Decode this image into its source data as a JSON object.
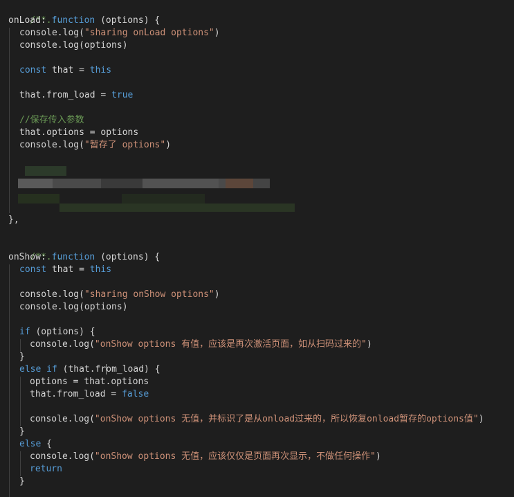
{
  "colors": {
    "background": "#1e1e1e",
    "keyword": "#569cd6",
    "string": "#ce9178",
    "comment": "#6a9955",
    "text": "#d4d4d4"
  },
  "code": {
    "l1_collapsed": "/**...",
    "l2_name": "onLoad",
    "l2_colon": ": ",
    "l2_function": "function",
    "l2_params": " (options) {",
    "l3_call": "console.log(",
    "l3_str": "\"sharing onLoad options\"",
    "l3_close": ")",
    "l4": "console.log(options)",
    "l5_const": "const",
    "l5_that": " that = ",
    "l5_this": "this",
    "l6_that": "that.from_load = ",
    "l6_true": "true",
    "l7_comment": "//保存传入参数",
    "l8": "that.options = options",
    "l9_call": "console.log(",
    "l9_str": "\"暂存了 options\"",
    "l9_close": ")",
    "l10_close": "},",
    "l11_collapsed": "/**...",
    "l12_name": "onShow",
    "l12_colon": ": ",
    "l12_function": "function",
    "l12_params": " (options) {",
    "l13_const": "const",
    "l13_that": " that = ",
    "l13_this": "this",
    "l14_call": "console.log(",
    "l14_str": "\"sharing onShow options\"",
    "l14_close": ")",
    "l15": "console.log(options)",
    "l16_if": "if",
    "l16_rest": " (options) {",
    "l17_call": "console.log(",
    "l17_str": "\"onShow options 有值，应该是再次激活页面，如从扫码过来的\"",
    "l17_close": ")",
    "l18": "}",
    "l19_else": "else",
    "l19_sp": " ",
    "l19_if": "if",
    "l19_rest_a": " (that.fr",
    "l19_rest_b": "om_load) {",
    "l20": "options = that.options",
    "l21_that": "that.from_load = ",
    "l21_false": "false",
    "l22_call": "console.log(",
    "l22_str": "\"onShow options 无值，并标识了是从onload过来的，所以恢复onload暂存的options值\"",
    "l22_close": ")",
    "l23": "}",
    "l24_else": "else",
    "l24_rest": " {",
    "l25_call": "console.log(",
    "l25_str": "\"onShow options 无值，应该仅仅是页面再次显示，不做任何操作\"",
    "l25_close": ")",
    "l26_return": "return",
    "l27": "}"
  }
}
